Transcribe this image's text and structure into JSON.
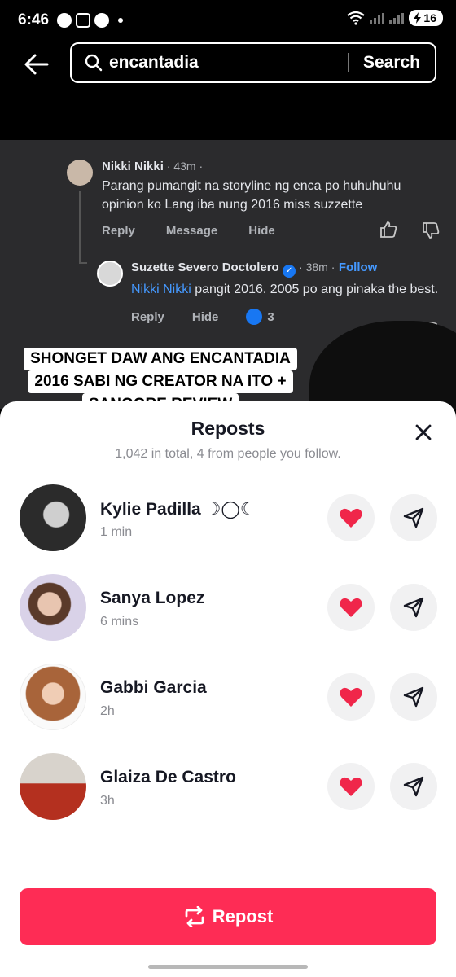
{
  "status_bar": {
    "time": "6:46",
    "battery": "16"
  },
  "search": {
    "query": "encantadia",
    "button": "Search"
  },
  "video": {
    "comment1": {
      "name": "Nikki Nikki",
      "meta": " · 43m ·",
      "text": "Parang pumangit na storyline ng enca po huhuhuhu opinion ko Lang iba nung 2016 miss suzzette",
      "actions": [
        "Reply",
        "Message",
        "Hide"
      ]
    },
    "comment2": {
      "name": "Suzette Severo Doctolero",
      "meta": " · 38m ·",
      "follow": "Follow",
      "mention": "Nikki Nikki",
      "text": " pangit 2016. 2005 po ang pinaka the best.",
      "actions": [
        "Reply",
        "Hide"
      ],
      "likes": "3"
    },
    "caption": [
      "SHONGET DAW ANG ENCANTADIA",
      "2016 SABI NG CREATOR NA ITO +",
      "SANGGRE REVIEW"
    ]
  },
  "sheet": {
    "title": "Reposts",
    "subtitle": "1,042 in total, 4 from people you follow.",
    "users": [
      {
        "name": "Kylie Padilla ☽◯☾",
        "time": "1 min"
      },
      {
        "name": "Sanya Lopez",
        "time": "6 mins"
      },
      {
        "name": "Gabbi Garcia",
        "time": "2h"
      },
      {
        "name": "Glaiza De Castro",
        "time": "3h"
      }
    ],
    "repost_label": "Repost"
  },
  "colors": {
    "accent": "#fe2c55",
    "heart": "#f0264a",
    "fb_blue": "#1877f2"
  },
  "icons": [
    "back-arrow-icon",
    "search-icon",
    "close-icon",
    "heart-icon",
    "send-icon",
    "repost-icon",
    "thumbs-up-icon",
    "thumbs-down-icon"
  ]
}
